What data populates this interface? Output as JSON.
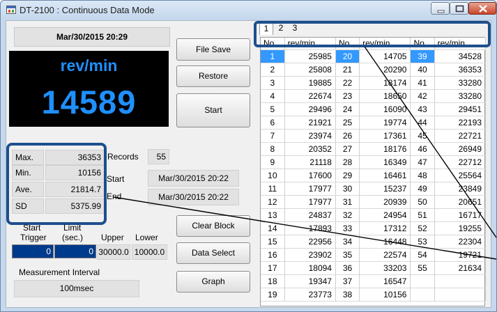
{
  "window": {
    "title": "DT-2100 : Continuous Data Mode"
  },
  "header": {
    "datetime": "Mar/30/2015 20:29"
  },
  "display": {
    "unit": "rev/min",
    "value": "14589"
  },
  "buttons": {
    "file_save": "File Save",
    "restore": "Restore",
    "start": "Start",
    "clear_block": "Clear Block",
    "data_select": "Data Select",
    "graph": "Graph"
  },
  "stats": {
    "max_label": "Max.",
    "max_value": "36353",
    "min_label": "Min.",
    "min_value": "10156",
    "ave_label": "Ave.",
    "ave_value": "21814.7",
    "sd_label": "SD",
    "sd_value": "5375.99"
  },
  "records": {
    "label": "Records",
    "value": "55"
  },
  "timing": {
    "start_label": "Start",
    "start_value": "Mar/30/2015 20:22",
    "end_label": "End",
    "end_value": "Mar/30/2015 20:22"
  },
  "trigger": {
    "start_trigger_label_1": "Start",
    "start_trigger_label_2": "Trigger",
    "limit_label_1": "Limit",
    "limit_label_2": "(sec.)",
    "upper_label": "Upper",
    "lower_label": "Lower",
    "start_trigger_value": "0",
    "limit_value": "0",
    "upper_value": "30000.0",
    "lower_value": "10000.0"
  },
  "interval": {
    "label": "Measurement Interval",
    "value": "100msec"
  },
  "tabs": [
    "1",
    "2",
    "3"
  ],
  "table": {
    "headers": [
      "No.",
      "rev/min",
      "No.",
      "rev/min",
      "No.",
      "rev/min"
    ],
    "rows": [
      [
        "1",
        "25985",
        "20",
        "14705",
        "39",
        "34528"
      ],
      [
        "2",
        "25808",
        "21",
        "20290",
        "40",
        "36353"
      ],
      [
        "3",
        "19885",
        "22",
        "18174",
        "41",
        "33280"
      ],
      [
        "4",
        "22674",
        "23",
        "18650",
        "42",
        "33280"
      ],
      [
        "5",
        "29496",
        "24",
        "16090",
        "43",
        "29451"
      ],
      [
        "6",
        "21921",
        "25",
        "19774",
        "44",
        "22193"
      ],
      [
        "7",
        "23974",
        "26",
        "17361",
        "45",
        "22721"
      ],
      [
        "8",
        "20352",
        "27",
        "18176",
        "46",
        "26949"
      ],
      [
        "9",
        "21118",
        "28",
        "16349",
        "47",
        "22712"
      ],
      [
        "10",
        "17600",
        "29",
        "16461",
        "48",
        "25564"
      ],
      [
        "11",
        "17977",
        "30",
        "15237",
        "49",
        "23849"
      ],
      [
        "12",
        "17977",
        "31",
        "20939",
        "50",
        "20651"
      ],
      [
        "13",
        "24837",
        "32",
        "24954",
        "51",
        "16717"
      ],
      [
        "14",
        "17893",
        "33",
        "17312",
        "52",
        "19255"
      ],
      [
        "15",
        "22956",
        "34",
        "16448",
        "53",
        "22304"
      ],
      [
        "16",
        "23902",
        "35",
        "22574",
        "54",
        "19721"
      ],
      [
        "17",
        "18094",
        "36",
        "33203",
        "55",
        "21634"
      ],
      [
        "18",
        "19347",
        "37",
        "16547",
        "",
        ""
      ],
      [
        "19",
        "23773",
        "38",
        "10156",
        "",
        ""
      ]
    ]
  },
  "colors": {
    "accent": "#1e90ff",
    "highlight": "#1e4f8c",
    "selected": "#3399ff"
  },
  "icons": [
    "app-icon",
    "minimize-icon",
    "maximize-icon",
    "close-icon"
  ]
}
